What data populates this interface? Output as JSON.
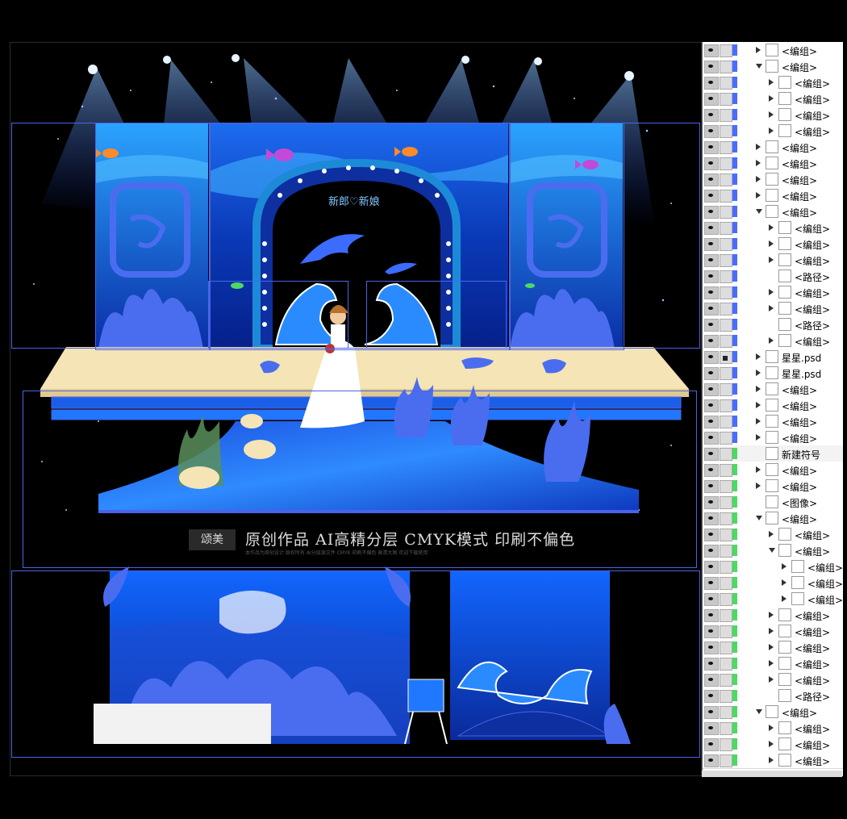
{
  "canvas": {
    "stage_caption": "新郎♡新娘",
    "watermark": {
      "logo": "颂美",
      "text": "原创作品 AI高精分层 CMYK模式 印刷不偏色",
      "fineprint": "本作品为原创设计 版权所有 AI分层源文件 CMYK 印刷不偏色 高清大图 欢迎下载使用"
    },
    "colors": {
      "deep": "#06208a",
      "mid": "#1a4fd6",
      "light": "#2fa8ff",
      "sand": "#f5e4b5",
      "selection": "#4a63e8"
    }
  },
  "layers": [
    {
      "name": "<编组>",
      "indent": 0,
      "arrow": "closed",
      "color": "#4b6bff"
    },
    {
      "name": "<编组>",
      "indent": 0,
      "arrow": "open",
      "color": "#4b6bff"
    },
    {
      "name": "<编组>",
      "indent": 1,
      "arrow": "closed",
      "color": "#4b6bff"
    },
    {
      "name": "<编组>",
      "indent": 1,
      "arrow": "closed",
      "color": "#4b6bff"
    },
    {
      "name": "<编组>",
      "indent": 1,
      "arrow": "closed",
      "color": "#4b6bff"
    },
    {
      "name": "<编组>",
      "indent": 1,
      "arrow": "closed",
      "color": "#4b6bff"
    },
    {
      "name": "<编组>",
      "indent": 0,
      "arrow": "closed",
      "color": "#4b6bff"
    },
    {
      "name": "<编组>",
      "indent": 0,
      "arrow": "closed",
      "color": "#4b6bff"
    },
    {
      "name": "<编组>",
      "indent": 0,
      "arrow": "closed",
      "color": "#4b6bff"
    },
    {
      "name": "<编组>",
      "indent": 0,
      "arrow": "closed",
      "color": "#4b6bff"
    },
    {
      "name": "<编组>",
      "indent": 0,
      "arrow": "open",
      "color": "#4b6bff"
    },
    {
      "name": "<编组>",
      "indent": 1,
      "arrow": "closed",
      "color": "#4b6bff"
    },
    {
      "name": "<编组>",
      "indent": 1,
      "arrow": "closed",
      "color": "#4b6bff"
    },
    {
      "name": "<编组>",
      "indent": 1,
      "arrow": "closed",
      "color": "#4b6bff"
    },
    {
      "name": "<路径>",
      "indent": 1,
      "arrow": "none",
      "color": "#4b6bff"
    },
    {
      "name": "<编组>",
      "indent": 1,
      "arrow": "closed",
      "color": "#4b6bff"
    },
    {
      "name": "<编组>",
      "indent": 1,
      "arrow": "closed",
      "color": "#4b6bff"
    },
    {
      "name": "<路径>",
      "indent": 1,
      "arrow": "none",
      "color": "#4b6bff"
    },
    {
      "name": "<编组>",
      "indent": 1,
      "arrow": "closed",
      "color": "#4b6bff"
    },
    {
      "name": "星星.psd",
      "indent": 0,
      "arrow": "closed",
      "color": "#4b6bff",
      "locked": true
    },
    {
      "name": "星星.psd",
      "indent": 0,
      "arrow": "closed",
      "color": "#4b6bff"
    },
    {
      "name": "<编组>",
      "indent": 0,
      "arrow": "closed",
      "color": "#4b6bff"
    },
    {
      "name": "<编组>",
      "indent": 0,
      "arrow": "closed",
      "color": "#4b6bff"
    },
    {
      "name": "<编组>",
      "indent": 0,
      "arrow": "closed",
      "color": "#4b6bff"
    },
    {
      "name": "<编组>",
      "indent": 0,
      "arrow": "closed",
      "color": "#4b6bff"
    },
    {
      "name": "新建符号",
      "indent": 0,
      "arrow": "none",
      "color": "#4cd964"
    },
    {
      "name": "<编组>",
      "indent": 0,
      "arrow": "closed",
      "color": "#4cd964"
    },
    {
      "name": "<编组>",
      "indent": 0,
      "arrow": "closed",
      "color": "#4cd964"
    },
    {
      "name": "<图像>",
      "indent": 0,
      "arrow": "none",
      "color": "#4cd964"
    },
    {
      "name": "<编组>",
      "indent": 0,
      "arrow": "open",
      "color": "#4cd964"
    },
    {
      "name": "<编组>",
      "indent": 1,
      "arrow": "closed",
      "color": "#4cd964"
    },
    {
      "name": "<编组>",
      "indent": 1,
      "arrow": "open",
      "color": "#4cd964"
    },
    {
      "name": "<编组>",
      "indent": 2,
      "arrow": "closed",
      "color": "#4cd964"
    },
    {
      "name": "<编组>",
      "indent": 2,
      "arrow": "closed",
      "color": "#4cd964"
    },
    {
      "name": "<编组>",
      "indent": 2,
      "arrow": "closed",
      "color": "#4cd964"
    },
    {
      "name": "<编组>",
      "indent": 1,
      "arrow": "closed",
      "color": "#4cd964"
    },
    {
      "name": "<编组>",
      "indent": 1,
      "arrow": "closed",
      "color": "#4cd964"
    },
    {
      "name": "<编组>",
      "indent": 1,
      "arrow": "closed",
      "color": "#4cd964"
    },
    {
      "name": "<编组>",
      "indent": 1,
      "arrow": "closed",
      "color": "#4cd964"
    },
    {
      "name": "<编组>",
      "indent": 1,
      "arrow": "closed",
      "color": "#4cd964"
    },
    {
      "name": "<路径>",
      "indent": 1,
      "arrow": "none",
      "color": "#4cd964"
    },
    {
      "name": "<编组>",
      "indent": 0,
      "arrow": "open",
      "color": "#4cd964"
    },
    {
      "name": "<编组>",
      "indent": 1,
      "arrow": "closed",
      "color": "#4cd964"
    },
    {
      "name": "<编组>",
      "indent": 1,
      "arrow": "closed",
      "color": "#4cd964"
    },
    {
      "name": "<编组>",
      "indent": 1,
      "arrow": "closed",
      "color": "#4cd964"
    }
  ]
}
